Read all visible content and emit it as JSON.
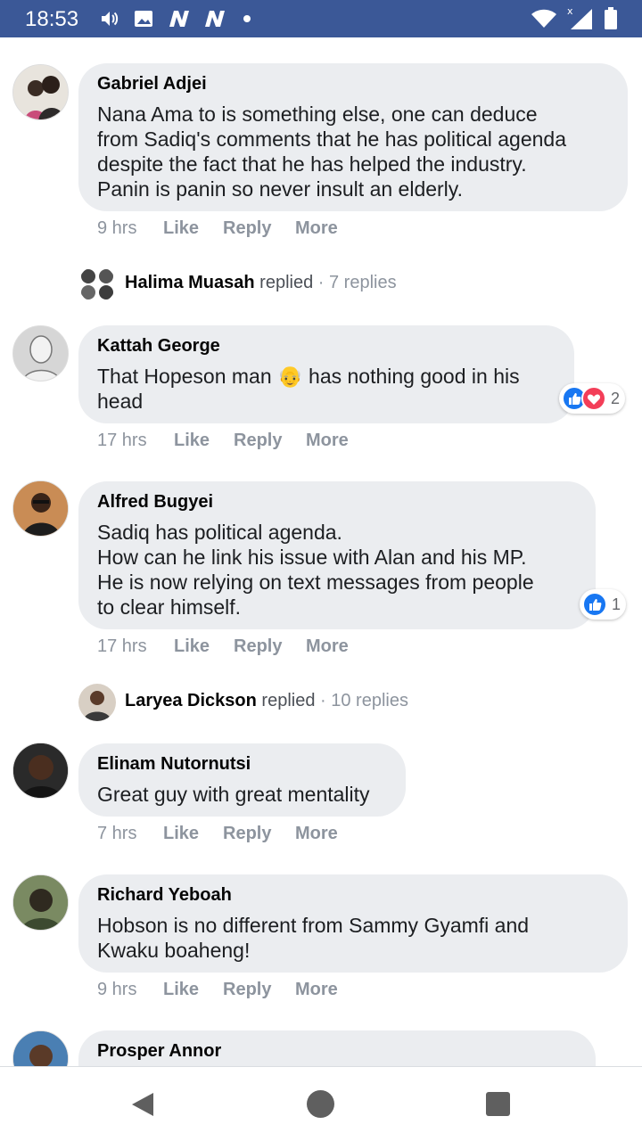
{
  "status_bar": {
    "time": "18:53",
    "icons": [
      "volume-icon",
      "image-icon",
      "n-app-icon",
      "n-app-icon",
      "notification-dot-icon",
      "wifi-icon",
      "signal-icon",
      "battery-icon"
    ],
    "background": "#3b5897"
  },
  "comments": [
    {
      "author": "Gabriel Adjei",
      "text": "Nana Ama to is something else, one can deduce\nfrom Sadiq's comments that he has political agenda\ndespite the fact that he has helped the industry.\nPanin is panin so never insult an elderly.",
      "time": "9 hrs",
      "like": "Like",
      "reply": "Reply",
      "more": "More"
    },
    {
      "author": "Kattah George",
      "text": "That Hopeson man 👴 has nothing good in his\nhead",
      "time": "17 hrs",
      "like": "Like",
      "reply": "Reply",
      "more": "More",
      "reaction_count": "2",
      "reactions": [
        "like",
        "love"
      ]
    },
    {
      "author": "Alfred Bugyei",
      "text": "Sadiq has political agenda.\nHow can he link his issue with Alan and his MP.\nHe is now relying on text messages from people\nto clear himself.",
      "time": "17 hrs",
      "like": "Like",
      "reply": "Reply",
      "more": "More",
      "reaction_count": "1",
      "reactions": [
        "like"
      ]
    },
    {
      "author": "Elinam Nutornutsi",
      "text": "Great guy with great mentality",
      "time": "7 hrs",
      "like": "Like",
      "reply": "Reply",
      "more": "More"
    },
    {
      "author": "Richard Yeboah",
      "text": "Hobson is no different from Sammy Gyamfi and\nKwaku boaheng!",
      "time": "9 hrs",
      "like": "Like",
      "reply": "Reply",
      "more": "More"
    },
    {
      "author": "Prosper Annor",
      "text": ""
    }
  ],
  "replies": [
    {
      "name": "Halima Muasah",
      "verb": "replied",
      "count": "· 7 replies"
    },
    {
      "name": "Laryea Dickson",
      "verb": "replied",
      "count": "· 10 replies"
    }
  ],
  "colors": {
    "bubble": "#ebedf0",
    "meta_text": "#8d949e",
    "like_blue": "#1877f2",
    "love_red": "#f33e58"
  }
}
